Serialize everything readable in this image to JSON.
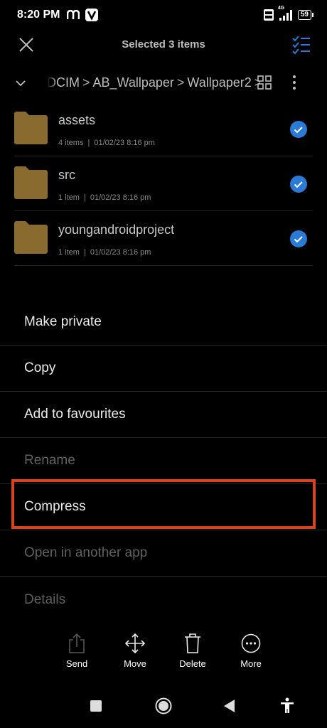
{
  "status": {
    "time": "8:20 PM",
    "network": "4G",
    "battery": "59"
  },
  "header": {
    "title": "Selected 3 items"
  },
  "breadcrumb": {
    "items": [
      "DCIM",
      "AB_Wallpaper",
      "Wallpaper2"
    ],
    "separator": ">"
  },
  "files": [
    {
      "name": "assets",
      "count": "4 items",
      "date": "01/02/23 8:16 pm",
      "checked": true
    },
    {
      "name": "src",
      "count": "1 item",
      "date": "01/02/23 8:16 pm",
      "checked": true
    },
    {
      "name": "youngandroidproject",
      "count": "1 item",
      "date": "01/02/23 8:16 pm",
      "checked": true
    }
  ],
  "menu": [
    {
      "label": "Make private",
      "enabled": true
    },
    {
      "label": "Copy",
      "enabled": true
    },
    {
      "label": "Add to favourites",
      "enabled": true
    },
    {
      "label": "Rename",
      "enabled": false
    },
    {
      "label": "Compress",
      "enabled": true
    },
    {
      "label": "Open in another app",
      "enabled": false
    },
    {
      "label": "Details",
      "enabled": false
    }
  ],
  "actions": {
    "send": "Send",
    "move": "Move",
    "delete": "Delete",
    "more": "More"
  },
  "colors": {
    "accent": "#2b7bd6",
    "folder": "#8a6b2f",
    "highlight": "#d9441e"
  }
}
